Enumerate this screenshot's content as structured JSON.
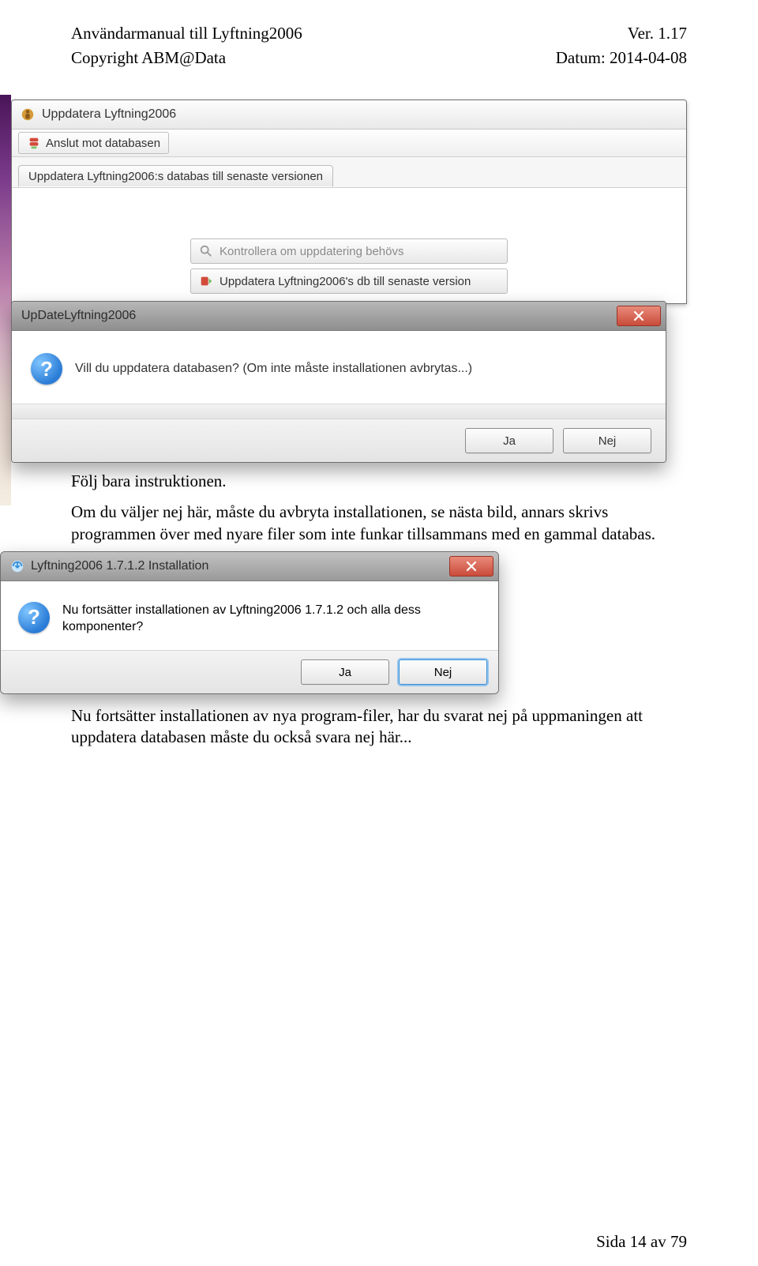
{
  "header": {
    "left1": "Användarmanual till Lyftning2006",
    "right1": "Ver. 1.17",
    "left2": "Copyright ABM@Data",
    "right2": "Datum: 2014-04-08"
  },
  "shot1": {
    "window_title": "Uppdatera Lyftning2006",
    "toolbar_chip": "Anslut mot databasen",
    "tab_label": "Uppdatera Lyftning2006:s databas till senaste versionen",
    "btn_check": "Kontrollera om uppdatering behövs",
    "btn_update": "Uppdatera Lyftning2006's db till senaste version",
    "dialog_title": "UpDateLyftning2006",
    "dialog_msg": "Vill du uppdatera databasen? (Om inte måste installationen avbrytas...)",
    "btn_yes": "Ja",
    "btn_no": "Nej"
  },
  "para1": "Följ bara instruktionen.",
  "para2": "Om du väljer nej här, måste du avbryta installationen, se nästa bild, annars skrivs programmen över med nyare filer som inte funkar tillsammans med en gammal databas.",
  "shot2": {
    "dialog_title": "Lyftning2006 1.7.1.2 Installation",
    "dialog_msg": "Nu fortsätter installationen av Lyftning2006 1.7.1.2 och alla dess komponenter?",
    "btn_yes": "Ja",
    "btn_no": "Nej"
  },
  "para3": "Nu fortsätter installationen av nya program-filer, har du svarat nej på uppmaningen att uppdatera databasen måste du också svara nej här...",
  "footer": "Sida 14 av 79"
}
